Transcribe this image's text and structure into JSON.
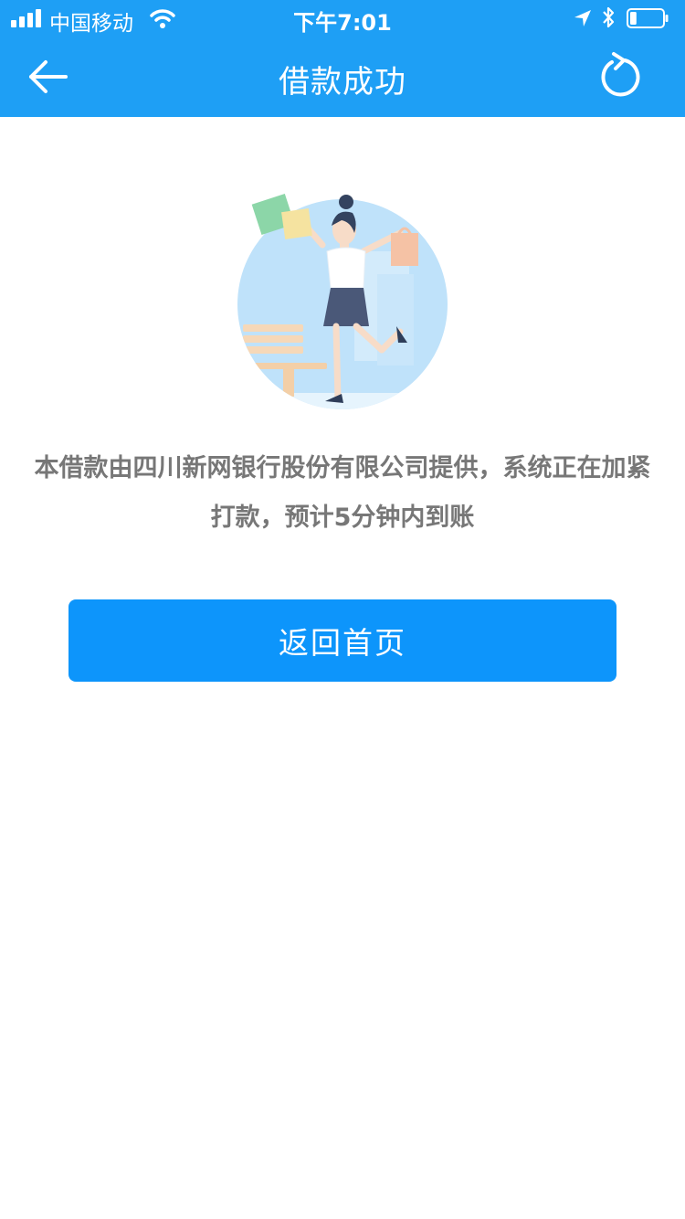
{
  "status_bar": {
    "carrier": "中国移动",
    "time": "下午7:01",
    "signal_bars": 4,
    "battery_level": 0.2
  },
  "nav": {
    "title": "借款成功",
    "back_icon": "arrow-left-icon",
    "refresh_icon": "refresh-icon"
  },
  "content": {
    "message": "本借款由四川新网银行股份有限公司提供，系统正在加紧打款，预计5分钟内到账",
    "home_button_label": "返回首页"
  },
  "colors": {
    "primary": "#1e9ff5",
    "button": "#0d95fb",
    "text": "#777777"
  }
}
